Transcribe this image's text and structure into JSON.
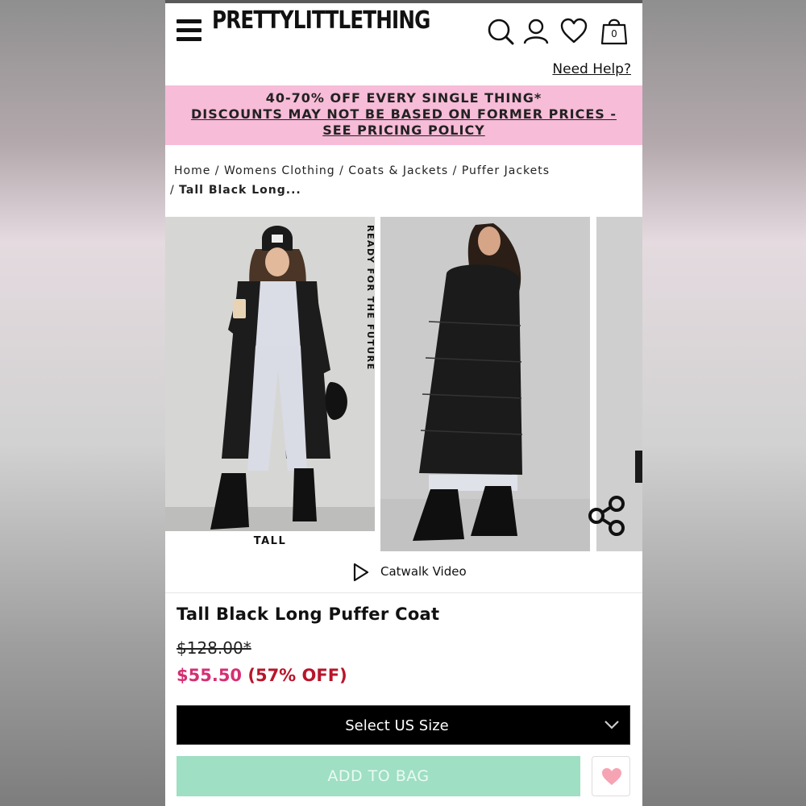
{
  "header": {
    "logo": "PRETTYLITTLETHING",
    "bag_count": "0",
    "need_help": "Need Help?",
    "icons": [
      "menu-icon",
      "search-icon",
      "account-icon",
      "wishlist-icon",
      "bag-icon"
    ]
  },
  "promo": {
    "line1": "40-70% OFF EVERY SINGLE THING*",
    "line2": "DISCOUNTS MAY NOT BE BASED ON FORMER PRICES - SEE PRICING POLICY",
    "background": "#f7bcd8"
  },
  "breadcrumb": {
    "home": "Home",
    "sep": " / ",
    "womens": "Womens Clothing",
    "coats": "Coats & Jackets",
    "puffer": "Puffer Jackets",
    "current": "Tall Black Long..."
  },
  "gallery": {
    "side_label": "READY FOR THE FUTURE",
    "tall_label": "TALL",
    "image_count_visible": 3
  },
  "video": {
    "label": "Catwalk Video"
  },
  "product": {
    "title": "Tall Black Long Puffer Coat",
    "old_price": "$128.00*",
    "price": "$55.50",
    "discount": "(57% OFF)",
    "price_color": "#d62f73",
    "discount_color": "#b8152a"
  },
  "actions": {
    "size_select": "Select US Size",
    "add_to_bag": "ADD TO BAG",
    "add_to_bag_color": "#9fdfc4",
    "wishlist_heart_color": "#f6a3b4"
  }
}
